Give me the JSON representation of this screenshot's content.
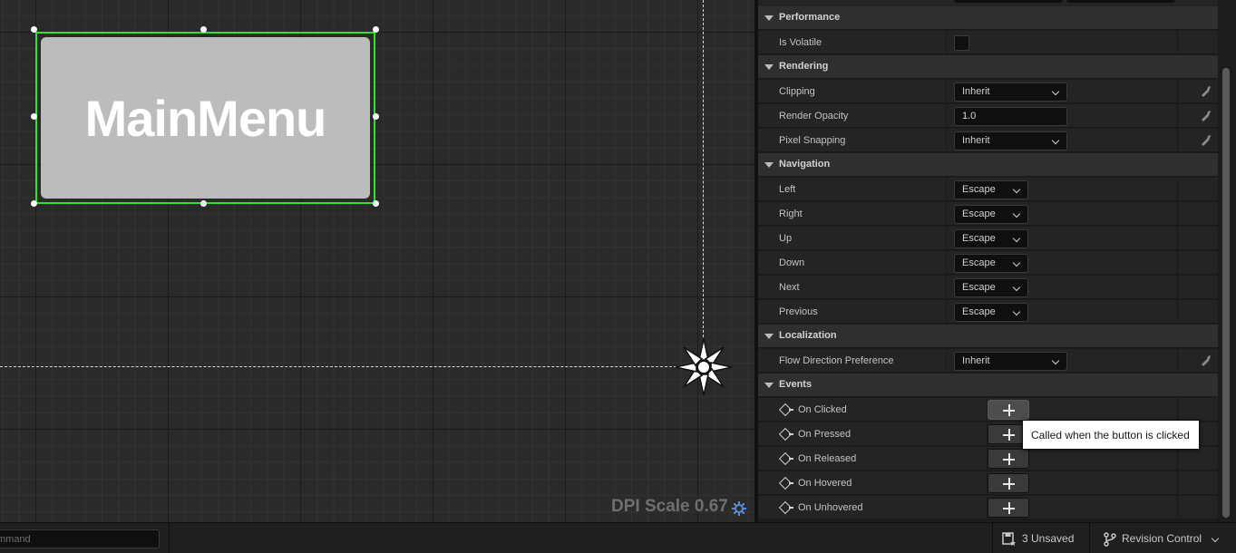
{
  "canvas": {
    "widget_text": "MainMenu",
    "dpi_scale_label": "DPI Scale 0.67"
  },
  "details": {
    "categories": {
      "performance": "Performance",
      "rendering": "Rendering",
      "navigation": "Navigation",
      "localization": "Localization",
      "events": "Events"
    },
    "performance": {
      "is_volatile_label": "Is Volatile"
    },
    "rendering": {
      "clipping_label": "Clipping",
      "clipping_value": "Inherit",
      "render_opacity_label": "Render Opacity",
      "render_opacity_value": "1.0",
      "pixel_snapping_label": "Pixel Snapping",
      "pixel_snapping_value": "Inherit"
    },
    "navigation": [
      {
        "label": "Left",
        "value": "Escape"
      },
      {
        "label": "Right",
        "value": "Escape"
      },
      {
        "label": "Up",
        "value": "Escape"
      },
      {
        "label": "Down",
        "value": "Escape"
      },
      {
        "label": "Next",
        "value": "Escape"
      },
      {
        "label": "Previous",
        "value": "Escape"
      }
    ],
    "localization": {
      "flow_direction_label": "Flow Direction Preference",
      "flow_direction_value": "Inherit"
    },
    "events": [
      {
        "label": "On Clicked"
      },
      {
        "label": "On Pressed"
      },
      {
        "label": "On Released"
      },
      {
        "label": "On Hovered"
      },
      {
        "label": "On Unhovered"
      }
    ],
    "tooltip": "Called when the button is clicked"
  },
  "statusbar": {
    "command_placeholder": "mmand",
    "unsaved_label": "3 Unsaved",
    "revision_control_label": "Revision Control"
  },
  "colors": {
    "selection_outline": "#2ee22e",
    "widget_fill": "#bcbcbc",
    "panel_bg": "#242424",
    "category_bg": "#2f2f2f"
  }
}
